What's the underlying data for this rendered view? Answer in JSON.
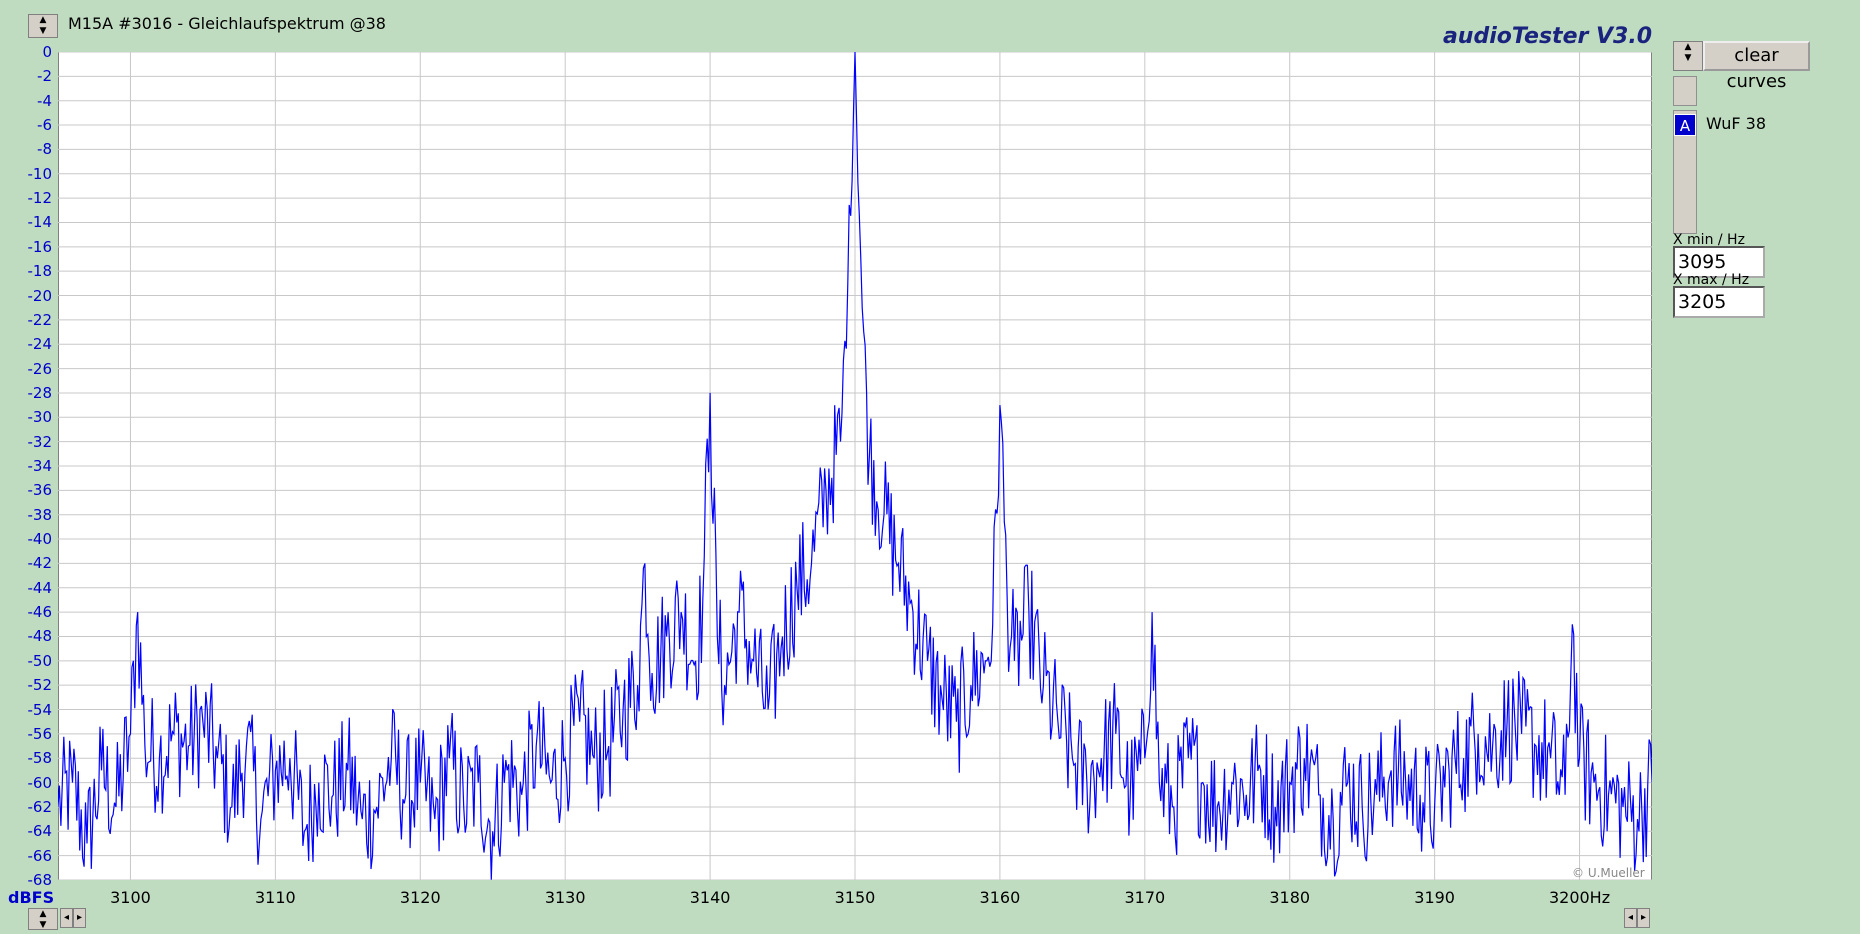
{
  "window": {
    "title": "M15A #3016 - Gleichlaufspektrum @38",
    "brand": "audioTester  V3.0",
    "copyright": "© U.Mueller"
  },
  "sidebar": {
    "clear_label": "clear curves",
    "curve_letter": "A",
    "curve_name": "WuF 38",
    "xmin_label": "X min  / Hz",
    "xmin_value": "3095",
    "xmax_label": "X max  / Hz",
    "xmax_value": "3205"
  },
  "colors": {
    "trace": "#0000ff",
    "background": "#c0dcc0",
    "plot_bg": "#ffffff",
    "grid": "#c8c8c8",
    "axis_text": "#0000cc"
  },
  "chart_data": {
    "type": "line",
    "ylabel": "dBFS",
    "xlim": [
      3095,
      3205
    ],
    "ylim": [
      -68,
      0
    ],
    "x_ticks": [
      "3100",
      "3110",
      "3120",
      "3130",
      "3140",
      "3150",
      "3160",
      "3170",
      "3180",
      "3190",
      "3200Hz"
    ],
    "y_ticks": [
      "0",
      "-2",
      "-4",
      "-6",
      "-8",
      "-10",
      "-12",
      "-14",
      "-16",
      "-18",
      "-20",
      "-22",
      "-24",
      "-26",
      "-28",
      "-30",
      "-32",
      "-34",
      "-36",
      "-38",
      "-40",
      "-42",
      "-44",
      "-46",
      "-48",
      "-50",
      "-52",
      "-54",
      "-56",
      "-58",
      "-60",
      "-62",
      "-64",
      "-66",
      "-68"
    ],
    "grid": true,
    "series": [
      {
        "name": "WuF 38",
        "x": [
          3095,
          3096,
          3097,
          3098,
          3099,
          3100,
          3100.5,
          3101,
          3102,
          3103,
          3104,
          3105,
          3106,
          3107,
          3108,
          3109,
          3110,
          3111,
          3112,
          3113,
          3114,
          3115,
          3116,
          3117,
          3118,
          3119,
          3120,
          3121,
          3122,
          3123,
          3124,
          3125,
          3126,
          3127,
          3128,
          3129,
          3130,
          3131,
          3132,
          3133,
          3134,
          3135,
          3135.5,
          3136,
          3137,
          3138,
          3139,
          3139.5,
          3140,
          3140.5,
          3141,
          3142,
          3143,
          3144,
          3145,
          3146,
          3147,
          3148,
          3149,
          3149.5,
          3150,
          3150.5,
          3151,
          3152,
          3153,
          3154,
          3155,
          3156,
          3157,
          3158,
          3159,
          3159.5,
          3160,
          3160.5,
          3161,
          3162,
          3163,
          3164,
          3165,
          3166,
          3167,
          3168,
          3169,
          3170,
          3170.5,
          3171,
          3172,
          3173,
          3174,
          3175,
          3176,
          3177,
          3178,
          3179,
          3180,
          3181,
          3182,
          3183,
          3184,
          3185,
          3186,
          3187,
          3188,
          3189,
          3190,
          3191,
          3192,
          3193,
          3194,
          3195,
          3196,
          3197,
          3198,
          3199,
          3199.5,
          3200,
          3201,
          3202,
          3203,
          3204,
          3205
        ],
        "y": [
          -62,
          -60,
          -65,
          -59,
          -62,
          -56,
          -46,
          -57,
          -58,
          -56,
          -57,
          -55,
          -58,
          -62,
          -57,
          -63,
          -59,
          -58,
          -64,
          -60,
          -61,
          -59,
          -63,
          -62,
          -58,
          -61,
          -60,
          -63,
          -58,
          -62,
          -60,
          -64,
          -59,
          -61,
          -57,
          -60,
          -58,
          -55,
          -58,
          -57,
          -54,
          -52,
          -42,
          -51,
          -48,
          -46,
          -50,
          -45,
          -28,
          -48,
          -52,
          -46,
          -50,
          -54,
          -48,
          -44,
          -42,
          -36,
          -32,
          -19,
          0,
          -21,
          -33,
          -38,
          -42,
          -46,
          -50,
          -53,
          -55,
          -52,
          -50,
          -47,
          -29,
          -45,
          -50,
          -46,
          -52,
          -55,
          -58,
          -60,
          -58,
          -56,
          -61,
          -58,
          -46,
          -60,
          -62,
          -58,
          -60,
          -62,
          -60,
          -61,
          -59,
          -62,
          -60,
          -58,
          -61,
          -63,
          -60,
          -62,
          -61,
          -59,
          -60,
          -61,
          -62,
          -59,
          -58,
          -56,
          -57,
          -55,
          -56,
          -57,
          -58,
          -61,
          -47,
          -58,
          -60,
          -61,
          -62,
          -63,
          -60
        ]
      }
    ]
  }
}
